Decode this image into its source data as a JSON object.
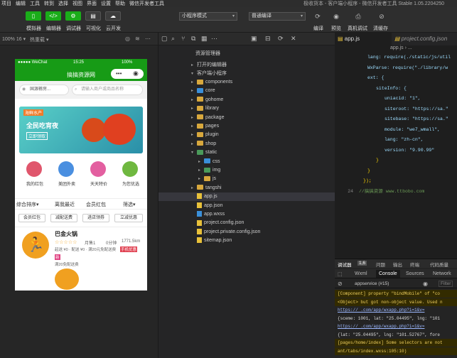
{
  "menubar": {
    "items": [
      "项目",
      "编辑",
      "工具",
      "转到",
      "选择",
      "视图",
      "界面",
      "设置",
      "帮助",
      "微信开发者工具"
    ],
    "window_title": "极收货本 - 客户端小程序 - 微信开发者工具 Stable 1.05.2204250"
  },
  "toolbar": {
    "buttons": [
      {
        "label": "模拟器"
      },
      {
        "label": "编辑器"
      },
      {
        "label": "调试器"
      },
      {
        "label": "可视化"
      },
      {
        "label": "云开发"
      }
    ],
    "mode_select": "小程序模式",
    "compile_select": "普通编译",
    "right_actions": [
      "编译",
      "预览",
      "真机调试",
      "清缓存"
    ]
  },
  "sim_header": {
    "zoom": "100% 16 ▾",
    "hot_reload": "热重载 ▾"
  },
  "phone": {
    "status_left": "●●●●● WeChat",
    "status_time": "15:25",
    "status_right": "100%",
    "nav_title": "搞搞资源网",
    "location_btn": "国源裤房...",
    "search_placeholder": "请输入商户或商品名称",
    "banner_tag": "海鲜水产",
    "banner_title": "全民吃宵夜",
    "banner_sub": "立即领取",
    "categories": [
      {
        "label": "我的红包",
        "color": "#e0566c"
      },
      {
        "label": "美团外卖",
        "color": "#4a8fe0"
      },
      {
        "label": "天天特价",
        "color": "#e35fa0"
      },
      {
        "label": "为您优选",
        "color": "#6fb840"
      }
    ],
    "sort_bar": [
      {
        "label": "综合排序",
        "arrow": "▾"
      },
      {
        "label": "离我最近",
        "arrow": ""
      },
      {
        "label": "会员红包",
        "arrow": ""
      },
      {
        "label": "筛选",
        "arrow": "▾"
      }
    ],
    "filter_chips": [
      "会员红包",
      "减配送费",
      "进店领券",
      "立减优惠"
    ],
    "shop": {
      "name": "巴金火锅",
      "rating": "☆☆☆☆☆",
      "monthly": "月售1",
      "time": "0分钟",
      "distance": "1771.5km",
      "min_line": "起送 ¥0 · 配送 ¥0 · 满20元免配送费",
      "tag_red": "手机优惠",
      "tag_badge": "新",
      "promo": "满20免配送费"
    }
  },
  "explorer": {
    "header": "资源管理器",
    "open_editors": "打开的编辑器",
    "project": "客户端小程序",
    "tree": [
      {
        "type": "folder",
        "name": "components",
        "color": "y",
        "indent": 1
      },
      {
        "type": "folder",
        "name": "core",
        "color": "b",
        "indent": 1
      },
      {
        "type": "folder",
        "name": "gohome",
        "color": "y",
        "indent": 1
      },
      {
        "type": "folder",
        "name": "library",
        "color": "y",
        "indent": 1
      },
      {
        "type": "folder",
        "name": "package",
        "color": "y",
        "indent": 1
      },
      {
        "type": "folder",
        "name": "pages",
        "color": "y",
        "indent": 1
      },
      {
        "type": "folder",
        "name": "plugin",
        "color": "y",
        "indent": 1
      },
      {
        "type": "folder",
        "name": "shop",
        "color": "y",
        "indent": 1
      },
      {
        "type": "folder",
        "name": "static",
        "color": "g",
        "indent": 1,
        "open": true
      },
      {
        "type": "folder",
        "name": "css",
        "color": "b",
        "indent": 2
      },
      {
        "type": "folder",
        "name": "img",
        "color": "g",
        "indent": 2
      },
      {
        "type": "folder",
        "name": "js",
        "color": "y",
        "indent": 2
      },
      {
        "type": "folder",
        "name": "tangshi",
        "color": "y",
        "indent": 1
      },
      {
        "type": "file",
        "name": "app.js",
        "ext": "js",
        "indent": 1,
        "selected": true
      },
      {
        "type": "file",
        "name": "app.json",
        "ext": "json",
        "indent": 1
      },
      {
        "type": "file",
        "name": "app.wxss",
        "ext": "wxss",
        "indent": 1
      },
      {
        "type": "file",
        "name": "project.config.json",
        "ext": "json",
        "indent": 1
      },
      {
        "type": "file",
        "name": "project.private.config.json",
        "ext": "json",
        "indent": 1
      },
      {
        "type": "file",
        "name": "sitemap.json",
        "ext": "json",
        "indent": 1
      }
    ]
  },
  "editor": {
    "tabs": [
      "app.js",
      "project.config.json"
    ],
    "breadcrumb": "app.js › ...",
    "lines": [
      {
        "n": "",
        "code": "lang: require(./static/js/util"
      },
      {
        "n": "",
        "code": "WxParse: require(\"./library/w"
      },
      {
        "n": "",
        "code": "ext: {"
      },
      {
        "n": "",
        "code": "siteInfo: {"
      },
      {
        "n": "",
        "code": "uniacid: \"1\","
      },
      {
        "n": "",
        "code": "siteroot: \"https://sa.\""
      },
      {
        "n": "",
        "code": "sitebase: \"https://sa.\""
      },
      {
        "n": "",
        "code": "module: \"we7_wmall\","
      },
      {
        "n": "",
        "code": "lang: \"zh-cn\","
      },
      {
        "n": "",
        "code": "version: \"9.90.99\""
      },
      {
        "n": "",
        "code": "}"
      },
      {
        "n": "",
        "code": "}"
      },
      {
        "n": "",
        "code": "});"
      },
      {
        "n": "24",
        "code": "//搞搞资源 www.ttbobo.com"
      }
    ]
  },
  "console": {
    "tabs": [
      "调试器",
      "1,6",
      "问题",
      "输出",
      "终端",
      "代码质量"
    ],
    "subtabs": [
      "Wxml",
      "Console",
      "Sources",
      "Network"
    ],
    "context": "appservice (#15)",
    "filter": "Filter",
    "lines": [
      "[Component] property \"bindMobile\" of \"co",
      "<Object> but got non-object value. Used n",
      "https://          .com/app/wxapp.php?i=1&v=",
      "{sceme: 1001, lat: \"25.04495\", lng: \"101",
      "https://          .com/app/wxapp.php?i=1&v=",
      "{lat: \"25.04495\", lng: \"101.52767\", fore",
      "[pages/home/index] Some selectors are not",
      "ant/tabs/index.wxss:105:10)"
    ]
  }
}
